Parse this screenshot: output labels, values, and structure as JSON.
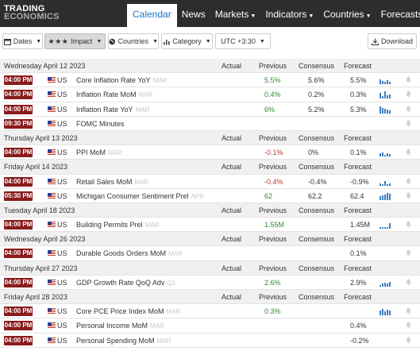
{
  "logo": {
    "line1": "TRADING",
    "line2": "ECONOMICS"
  },
  "nav": {
    "calendar": "Calendar",
    "news": "News",
    "markets": "Markets",
    "indicators": "Indicators",
    "countries": "Countries",
    "forecasts": "Forecasts"
  },
  "toolbar": {
    "dates": "Dates",
    "impact_stars": "★★★",
    "impact": "Impact",
    "countries": "Countries",
    "category": "Category",
    "timezone": "UTC +3:30",
    "download": "Download"
  },
  "columns": {
    "actual": "Actual",
    "previous": "Previous",
    "consensus": "Consensus",
    "forecast": "Forecast"
  },
  "days": [
    {
      "date": "Wednesday April 12 2023",
      "events": [
        {
          "time": "04:00 PM",
          "country": "US",
          "event": "Core Inflation Rate YoY",
          "ref": "MAR",
          "actual": "",
          "previous": "5.5%",
          "prev_color": "green",
          "consensus": "5.6%",
          "forecast": "5.5%",
          "spark": [
            0.6,
            0.4,
            0.3,
            0.5,
            0.3
          ]
        },
        {
          "time": "04:00 PM",
          "country": "US",
          "event": "Inflation Rate MoM",
          "ref": "MAR",
          "actual": "",
          "previous": "0.4%",
          "prev_color": "green",
          "consensus": "0.2%",
          "forecast": "0.3%",
          "spark": [
            0.7,
            0.3,
            0.9,
            0.4,
            0.5
          ]
        },
        {
          "time": "04:00 PM",
          "country": "US",
          "event": "Inflation Rate YoY",
          "ref": "MAR",
          "actual": "",
          "previous": "6%",
          "prev_color": "green",
          "consensus": "5.2%",
          "forecast": "5.3%",
          "spark": [
            0.9,
            0.7,
            0.6,
            0.5,
            0.4
          ]
        },
        {
          "time": "09:30 PM",
          "country": "US",
          "event": "FOMC Minutes",
          "ref": "",
          "actual": "",
          "previous": "",
          "prev_color": "",
          "consensus": "",
          "forecast": "",
          "spark": []
        }
      ]
    },
    {
      "date": "Thursday April 13 2023",
      "events": [
        {
          "time": "04:00 PM",
          "country": "US",
          "event": "PPI MoM",
          "ref": "MAR",
          "actual": "",
          "previous": "-0.1%",
          "prev_color": "red",
          "consensus": "0%",
          "forecast": "0.1%",
          "spark": [
            0.4,
            0.5,
            0.2,
            0.4,
            0.3
          ]
        }
      ]
    },
    {
      "date": "Friday April 14 2023",
      "events": [
        {
          "time": "04:00 PM",
          "country": "US",
          "event": "Retail Sales MoM",
          "ref": "MAR",
          "actual": "",
          "previous": "-0.4%",
          "prev_color": "red",
          "consensus": "-0.4%",
          "forecast": "-0.9%",
          "spark": [
            0.3,
            0.2,
            0.6,
            0.2,
            0.3
          ]
        },
        {
          "time": "05:30 PM",
          "country": "US",
          "event": "Michigan Consumer Sentiment Prel",
          "ref": "APR",
          "actual": "",
          "previous": "62",
          "prev_color": "green",
          "consensus": "62.2",
          "forecast": "62.4",
          "spark": [
            0.5,
            0.6,
            0.7,
            0.9,
            0.8
          ]
        }
      ]
    },
    {
      "date": "Tuesday April 18 2023",
      "events": [
        {
          "time": "04:00 PM",
          "country": "US",
          "event": "Building Permits Prel",
          "ref": "MAR",
          "actual": "",
          "previous": "1.55M",
          "prev_color": "green",
          "consensus": "",
          "forecast": "1.45M",
          "spark": [
            0.2,
            0.2,
            0.2,
            0.2,
            0.7
          ]
        }
      ]
    },
    {
      "date": "Wednesday April 26 2023",
      "events": [
        {
          "time": "04:00 PM",
          "country": "US",
          "event": "Durable Goods Orders MoM",
          "ref": "MAR",
          "actual": "",
          "previous": "",
          "prev_color": "",
          "consensus": "",
          "forecast": "0.1%",
          "spark": []
        }
      ]
    },
    {
      "date": "Thursday April 27 2023",
      "events": [
        {
          "time": "04:00 PM",
          "country": "US",
          "event": "GDP Growth Rate QoQ Adv",
          "ref": "Q1",
          "actual": "",
          "previous": "2.6%",
          "prev_color": "green",
          "consensus": "",
          "forecast": "2.9%",
          "spark": [
            0.2,
            0.4,
            0.5,
            0.4,
            0.6
          ]
        }
      ]
    },
    {
      "date": "Friday April 28 2023",
      "events": [
        {
          "time": "04:00 PM",
          "country": "US",
          "event": "Core PCE Price Index MoM",
          "ref": "MAR",
          "actual": "",
          "previous": "0.3%",
          "prev_color": "green",
          "consensus": "",
          "forecast": "",
          "spark": [
            0.6,
            0.8,
            0.5,
            0.7,
            0.6
          ]
        },
        {
          "time": "04:00 PM",
          "country": "US",
          "event": "Personal Income MoM",
          "ref": "MAR",
          "actual": "",
          "previous": "",
          "prev_color": "",
          "consensus": "",
          "forecast": "0.4%",
          "spark": []
        },
        {
          "time": "04:00 PM",
          "country": "US",
          "event": "Personal Spending MoM",
          "ref": "MAR",
          "actual": "",
          "previous": "",
          "prev_color": "",
          "consensus": "",
          "forecast": "-0.2%",
          "spark": []
        }
      ]
    }
  ]
}
